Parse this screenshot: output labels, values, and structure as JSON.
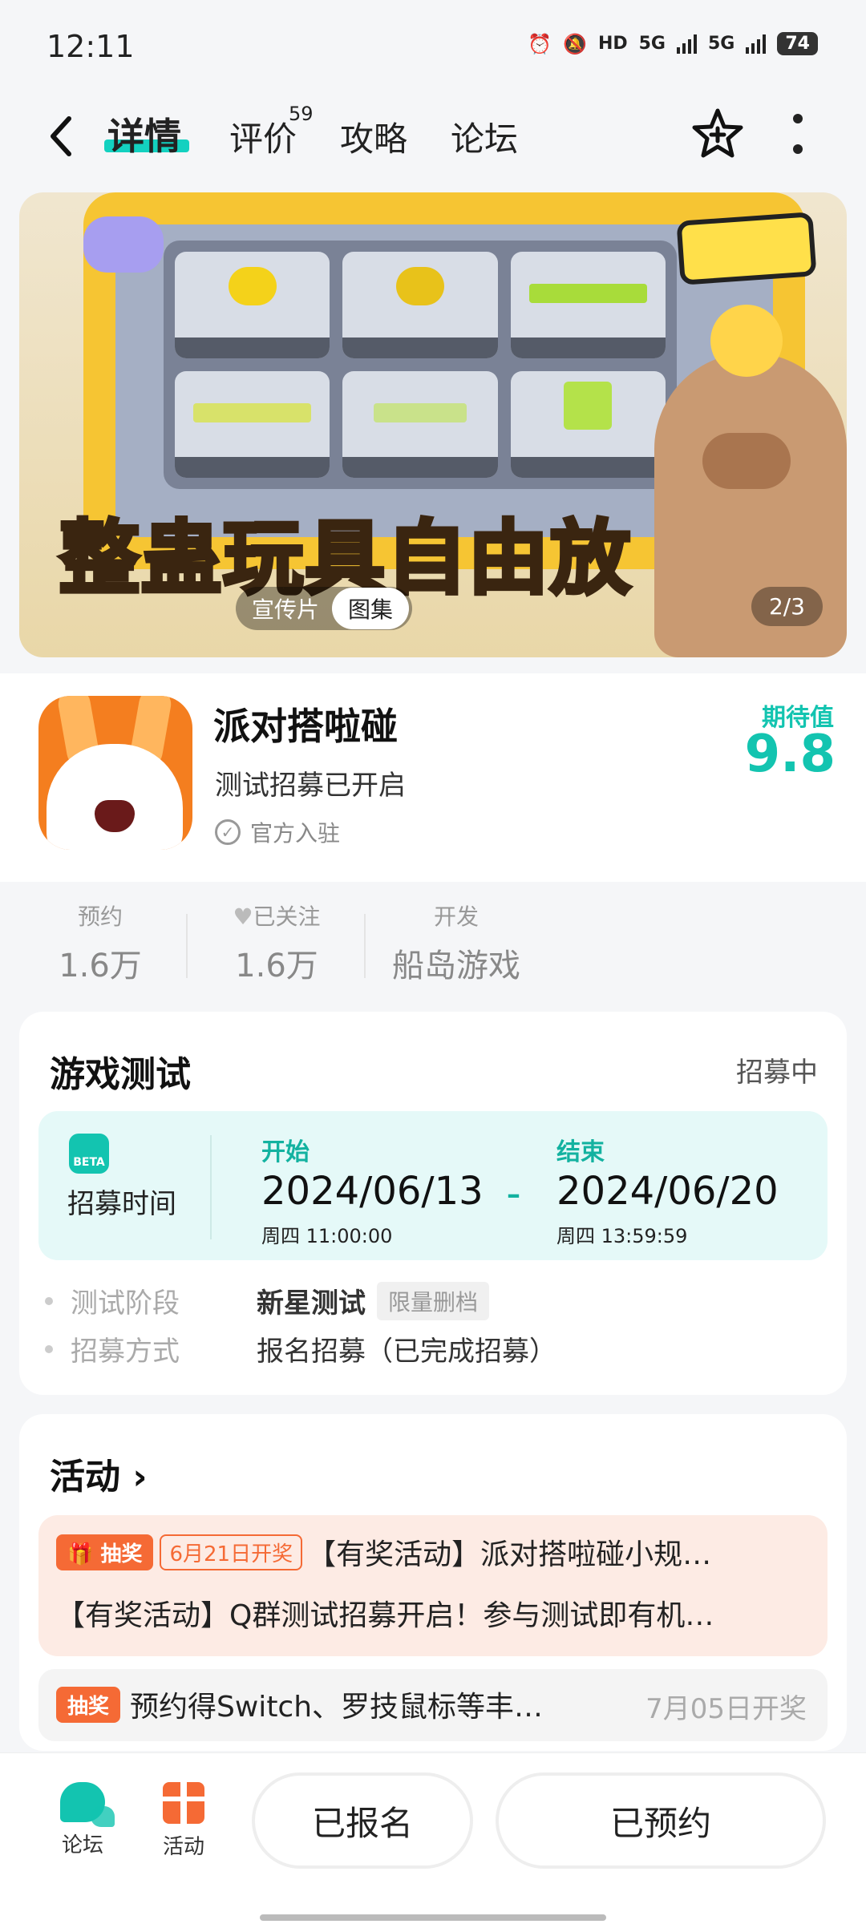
{
  "status_bar": {
    "time": "12:11",
    "net1": "HD",
    "net2": "5G",
    "net3": "5G",
    "battery": "74"
  },
  "nav": {
    "tabs": [
      {
        "label": "详情",
        "active": true
      },
      {
        "label": "评价",
        "badge": "59"
      },
      {
        "label": "攻略"
      },
      {
        "label": "论坛"
      }
    ],
    "accent": "#13d1c0"
  },
  "banner": {
    "slogan": "整蛊玩具自由放",
    "media_tabs": [
      "宣传片",
      "图集"
    ],
    "active_media_tab": "图集",
    "counter": "2/3"
  },
  "game": {
    "name": "派对搭啦碰",
    "status": "测试招募已开启",
    "official": "官方入驻",
    "score_label": "期待值",
    "score": "9.8"
  },
  "stats": [
    {
      "label": "预约",
      "value": "1.6万"
    },
    {
      "label": "已关注",
      "value": "1.6万"
    },
    {
      "label": "开发",
      "value": "船岛游戏"
    }
  ],
  "test": {
    "title": "游戏测试",
    "state": "招募中",
    "recruit_label": "招募时间",
    "beta_tag": "BETA",
    "start": {
      "head": "开始",
      "date": "2024/06/13",
      "sub": "周四  11:00:00"
    },
    "end": {
      "head": "结束",
      "date": "2024/06/20",
      "sub": "周四  13:59:59"
    },
    "separator": "–",
    "phase_label": "测试阶段",
    "phase_value": "新星测试",
    "phase_tag": "限量删档",
    "method_label": "招募方式",
    "method_value": "报名招募（已完成招募）"
  },
  "activity": {
    "title": "活动",
    "chevron": "›",
    "items": [
      {
        "badge": "抽奖",
        "date_tag": "6月21日开奖",
        "line1": "【有奖活动】派对搭啦碰小规…",
        "line2": "【有奖活动】Q群测试招募开启！参与测试即有机…"
      },
      {
        "badge": "抽奖",
        "line1": "预约得Switch、罗技鼠标等丰…",
        "date": "7月05日开奖"
      }
    ]
  },
  "bottom": {
    "forum_label": "论坛",
    "activity_label": "活动",
    "signed_button": "已报名",
    "reserved_button": "已预约"
  }
}
